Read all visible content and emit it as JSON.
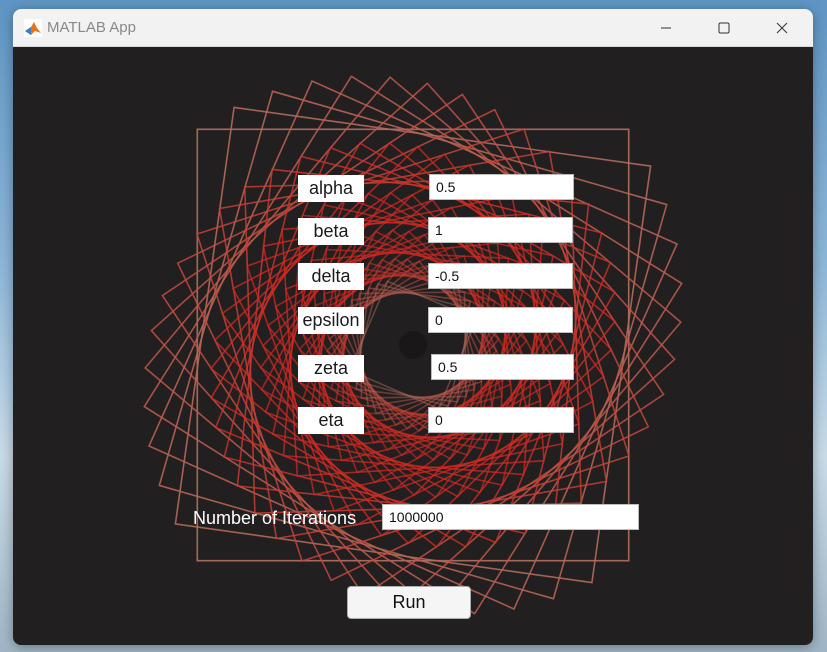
{
  "window": {
    "title": "MATLAB App",
    "app_icon": "matlab-logo-icon",
    "controls": [
      "minimize-icon",
      "maximize-icon",
      "close-icon"
    ]
  },
  "params": [
    {
      "label": "alpha",
      "value": "0.5"
    },
    {
      "label": "beta",
      "value": "1"
    },
    {
      "label": "delta",
      "value": "-0.5"
    },
    {
      "label": "epsilon",
      "value": "0"
    },
    {
      "label": "zeta",
      "value": "0.5"
    },
    {
      "label": "eta",
      "value": "0"
    }
  ],
  "iterations": {
    "label": "Number of Iterations",
    "value": "1000000"
  },
  "run_label": "Run",
  "colors": {
    "background": "#221f20",
    "line_outer": "#b47060",
    "line_inner": "#d42a22"
  }
}
